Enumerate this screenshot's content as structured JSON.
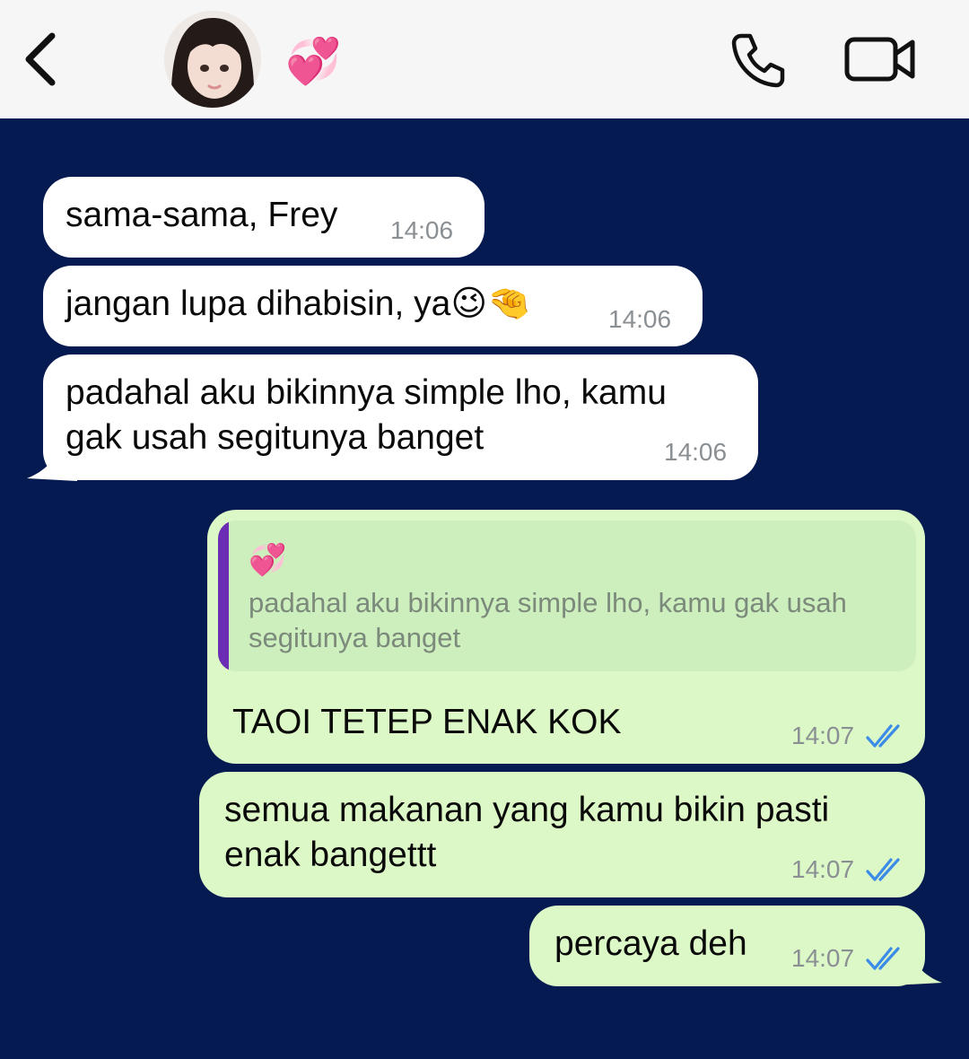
{
  "header": {
    "contact_name": "💞",
    "back_icon": "chevron-left-icon",
    "call_icon": "phone-icon",
    "video_icon": "video-camera-icon"
  },
  "colors": {
    "chat_background": "#061a52",
    "incoming_bubble": "#ffffff",
    "outgoing_bubble": "#dcf8c6",
    "read_tick": "#3b8be8",
    "quote_bar": "#6a2db4"
  },
  "messages": [
    {
      "direction": "in",
      "text": "sama-sama, Frey",
      "time": "14:06"
    },
    {
      "direction": "in",
      "text": "jangan lupa dihabisin, ya😉🤏",
      "time": "14:06"
    },
    {
      "direction": "in",
      "text": "padahal aku bikinnya simple lho, kamu\ngak usah segitunya banget",
      "time": "14:06"
    },
    {
      "direction": "out",
      "text": "TAOI TETEP ENAK KOK",
      "time": "14:07",
      "status": "read",
      "quote": {
        "author": "💞",
        "text": "padahal aku bikinnya simple lho, kamu gak usah segitunya banget"
      }
    },
    {
      "direction": "out",
      "text": "semua makanan yang kamu bikin pasti\nenak bangettt",
      "time": "14:07",
      "status": "read"
    },
    {
      "direction": "out",
      "text": "percaya deh",
      "time": "14:07",
      "status": "read"
    }
  ]
}
